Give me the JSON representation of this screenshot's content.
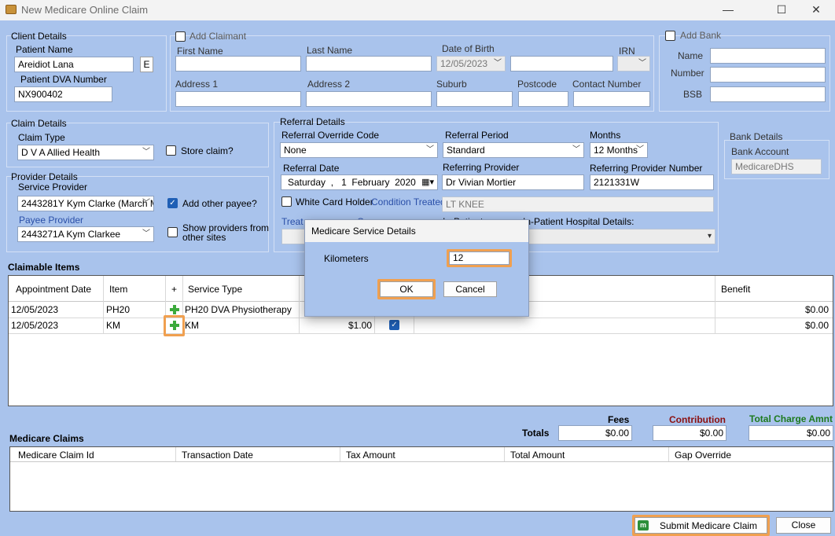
{
  "window": {
    "title": "New Medicare Online Claim",
    "minimize": "—",
    "maximize": "☐",
    "close": "✕"
  },
  "client": {
    "group_label": "Client Details",
    "patient_name_label": "Patient Name",
    "patient_name": "Areidiot Lana",
    "e_button": "E",
    "dva_label": "Patient DVA Number",
    "dva_number": "NX900402"
  },
  "claimant": {
    "add_label": "Add Claimant",
    "first_name_label": "First Name",
    "last_name_label": "Last Name",
    "dob_label": "Date of Birth",
    "dob_value": "12/05/2023",
    "irn_label": "IRN",
    "address1_label": "Address 1",
    "address2_label": "Address 2",
    "suburb_label": "Suburb",
    "postcode_label": "Postcode",
    "contact_label": "Contact Number"
  },
  "bank": {
    "add_label": "Add Bank",
    "name_label": "Name",
    "number_label": "Number",
    "bsb_label": "BSB"
  },
  "claim": {
    "group_label": "Claim Details",
    "type_label": "Claim Type",
    "type_value": "D V A Allied Health",
    "store_label": "Store claim?"
  },
  "provider": {
    "group_label": "Provider Details",
    "service_label": "Service Provider",
    "service_value": "2443281Y Kym Clarke (March M",
    "add_payee_label": "Add other payee?",
    "payee_label": "Payee Provider",
    "payee_value": "2443271A Kym Clarkee",
    "show_label_1": "Show providers from",
    "show_label_2": "other sites"
  },
  "referral": {
    "group_label": "Referral Details",
    "override_label": "Referral Override Code",
    "override_value": "None",
    "period_label": "Referral Period",
    "period_value": "Standard",
    "months_label": "Months",
    "months_value": "12 Months",
    "date_label": "Referral Date",
    "date_day": "Saturday",
    "date_sep": ",",
    "date_d": "1",
    "date_month": "February",
    "date_year": "2020",
    "provider_label": "Referring Provider",
    "provider_value": "Dr Vivian Mortier",
    "provider_number_label": "Referring Provider Number",
    "provider_number_value": "2121331W",
    "white_card_label": "White Card Holder",
    "condition_label": "Condition Treated",
    "condition_value": "LT KNEE",
    "treat_label_part": "Treat",
    "treat_label_part2": "O",
    "in_patient_part": "In-Patient",
    "hospital_label": "In-Patient Hospital Details:"
  },
  "bank_details": {
    "group_label": "Bank Details",
    "account_label": "Bank Account",
    "account_value": "MedicareDHS"
  },
  "claimable": {
    "title": "Claimable Items",
    "headers": {
      "appt": "Appointment Date",
      "item": "Item",
      "plus": "+",
      "service": "Service Type",
      "benefit": "Benefit"
    },
    "rows": [
      {
        "date": "12/05/2023",
        "item": "PH20",
        "service": "PH20 DVA Physiotherapy",
        "fee": "",
        "benefit": "$0.00"
      },
      {
        "date": "12/05/2023",
        "item": "KM",
        "service": "KM",
        "fee": "$1.00",
        "benefit": "$0.00"
      }
    ]
  },
  "totals": {
    "fees_label": "Fees",
    "contribution_label": "Contribution",
    "total_charge_label": "Total Charge Amnt",
    "totals_label": "Totals",
    "fees_value": "$0.00",
    "contribution_value": "$0.00",
    "total_charge_value": "$0.00",
    "colors": {
      "contribution": "#8b1010",
      "total_charge": "#1d7a1d"
    }
  },
  "medicare_claims": {
    "title": "Medicare Claims",
    "headers": {
      "id": "Medicare Claim Id",
      "date": "Transaction Date",
      "tax": "Tax Amount",
      "total": "Total Amount",
      "gap": "Gap Override"
    }
  },
  "footer": {
    "submit_label": "Submit Medicare Claim",
    "close_label": "Close"
  },
  "dialog": {
    "title": "Medicare Service Details",
    "km_label": "Kilometers",
    "km_value": "12",
    "ok_label": "OK",
    "cancel_label": "Cancel"
  },
  "accent": "#f0a050"
}
